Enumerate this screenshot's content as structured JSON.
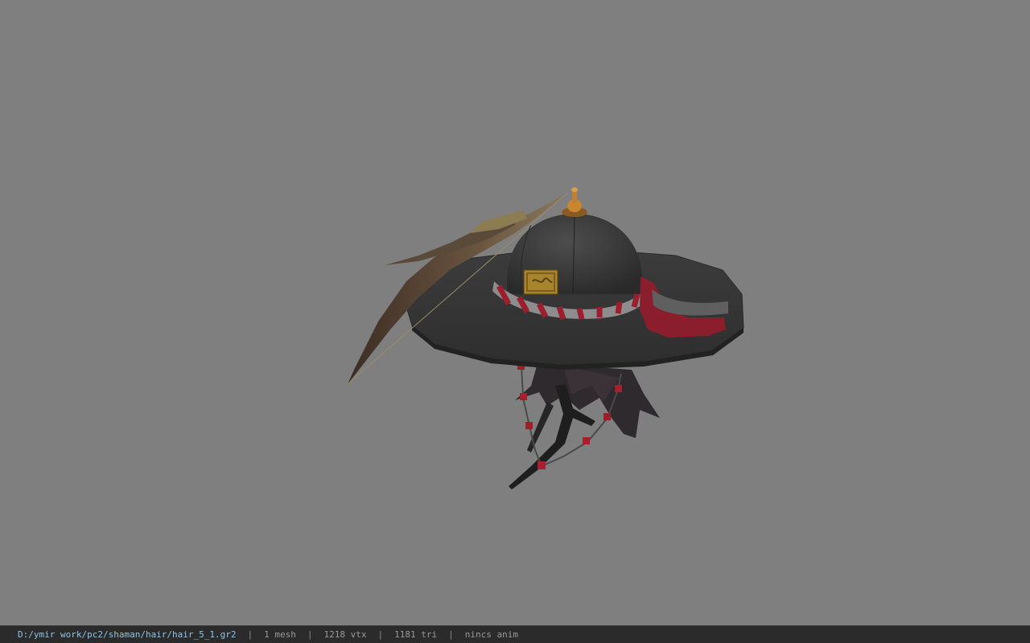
{
  "viewer": {
    "background_color": "#7f7f7f"
  },
  "model": {
    "icon": "hat-model"
  },
  "statusbar": {
    "file_path": "D:/ymir work/pc2/shaman/hair/hair_5_1.gr2",
    "separator": "|",
    "mesh_count": "1 mesh",
    "vertex_count": "1218 vtx",
    "triangle_count": "1181 tri",
    "animation": "nincs anim"
  }
}
